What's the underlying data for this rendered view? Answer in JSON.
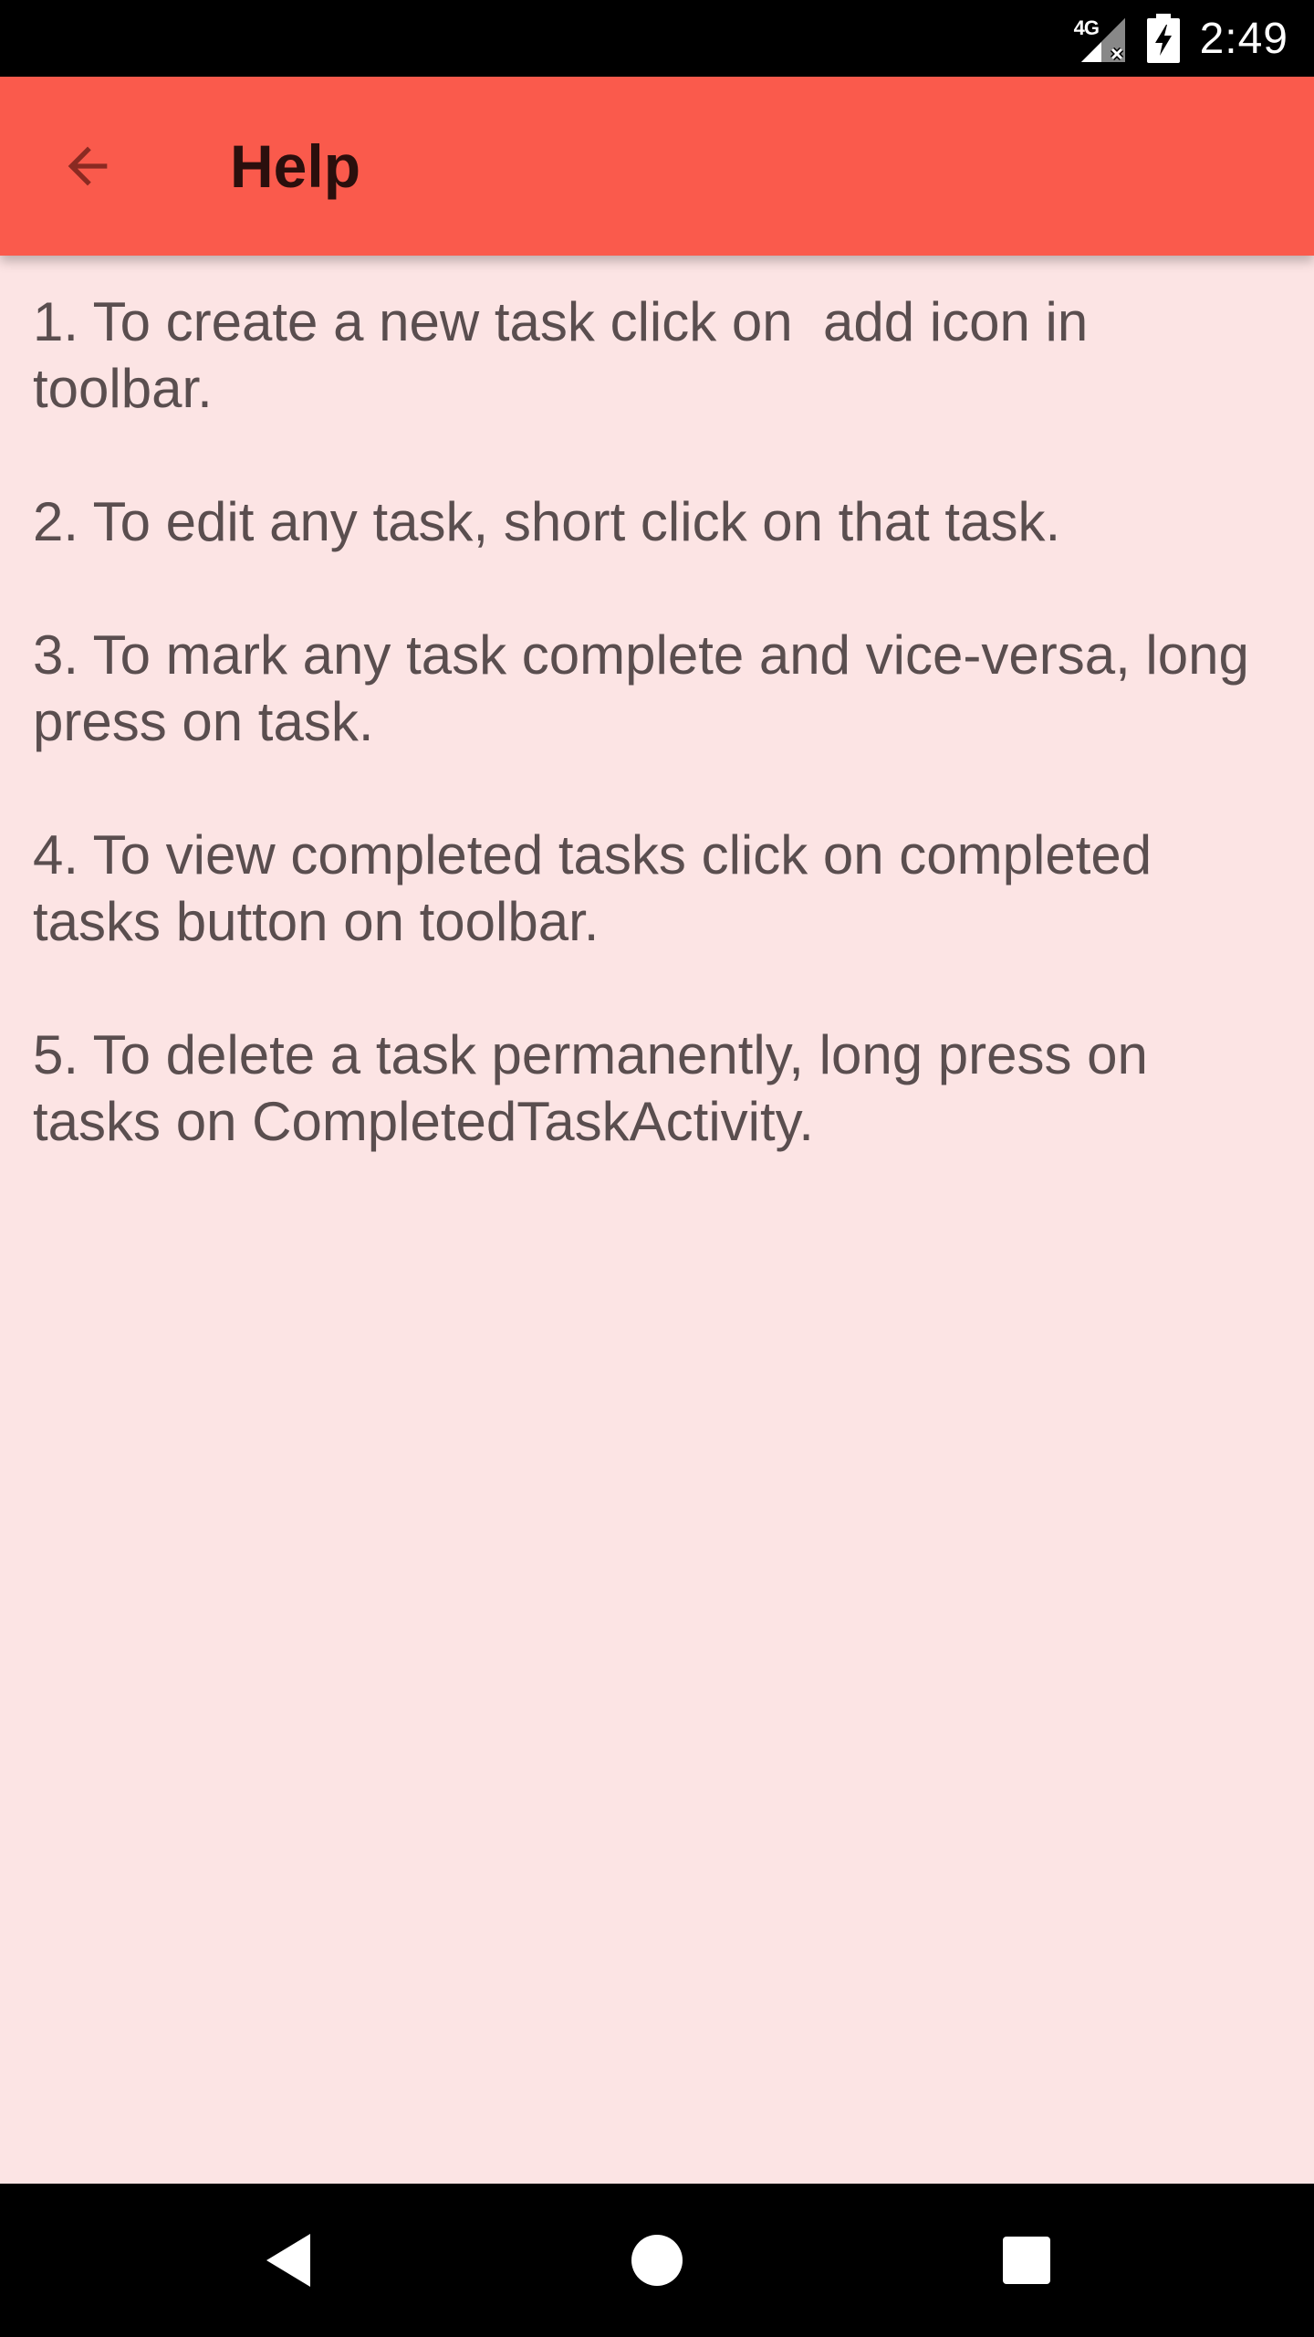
{
  "status_bar": {
    "network_label": "4G",
    "time": "2:49"
  },
  "toolbar": {
    "title": "Help",
    "back_icon": "arrow-back-icon"
  },
  "help_items": [
    "1. To create a new task click on  add icon in toolbar.",
    "2. To edit any task, short click on that task.",
    "3. To mark any task complete and vice-versa, long press on task.",
    "4. To view completed tasks click on completed tasks button on toolbar.",
    "5. To delete a task permanently, long press on tasks on CompletedTaskActivity."
  ],
  "nav_bar": {
    "back_icon": "nav-back-triangle-icon",
    "home_icon": "nav-home-circle-icon",
    "recents_icon": "nav-recents-square-icon"
  },
  "colors": {
    "toolbar": "#fa5a4c",
    "background": "#fce4e4",
    "text": "#5a4e4f",
    "title": "#2b0f0d"
  }
}
